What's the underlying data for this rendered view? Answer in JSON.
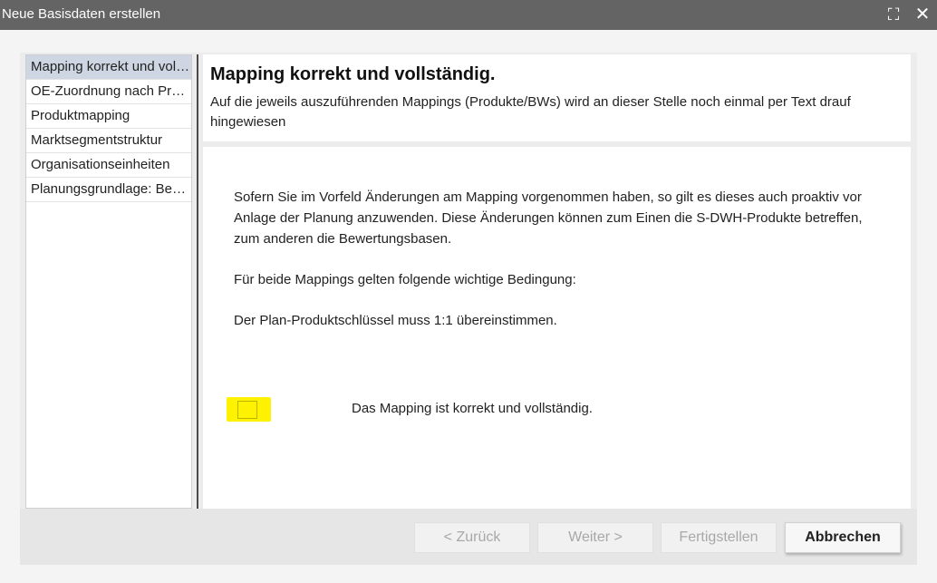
{
  "window": {
    "title": "Neue Basisdaten erstellen",
    "maximize_icon": "maximize-icon",
    "close_icon": "close-icon"
  },
  "steps": [
    {
      "label": "Mapping korrekt und vollständig.",
      "active": true
    },
    {
      "label": "OE-Zuordnung nach Produktmapping"
    },
    {
      "label": "Produktmapping"
    },
    {
      "label": "Marktsegmentstruktur"
    },
    {
      "label": "Organisationseinheiten"
    },
    {
      "label": "Planungsgrundlage: Bestand"
    }
  ],
  "header": {
    "title": "Mapping korrekt und vollständig.",
    "description": "Auf die jeweils auszuführenden Mappings (Produkte/BWs) wird an dieser Stelle noch einmal per Text drauf hingewiesen"
  },
  "content": {
    "paragraphs": [
      "Sofern Sie im Vorfeld Änderungen am Mapping vorgenommen haben, so gilt es dieses auch proaktiv vor Anlage der Planung anzuwenden. Diese Änderungen können zum Einen die S-DWH-Produkte betreffen, zum anderen die Bewertungsbasen.",
      "Für beide Mappings gelten folgende wichtige Bedingung:",
      "Der Plan-Produktschlüssel muss 1:1 übereinstimmen."
    ],
    "checkbox_label": "Das Mapping ist korrekt und vollständig.",
    "checkbox_checked": false,
    "highlight_color": "#fff200"
  },
  "buttons": {
    "back": "< Zurück",
    "next": "Weiter >",
    "finish": "Fertigstellen",
    "cancel": "Abbrechen"
  },
  "colors": {
    "titlebar": "#646464",
    "active_step": "#cdd6e2"
  }
}
